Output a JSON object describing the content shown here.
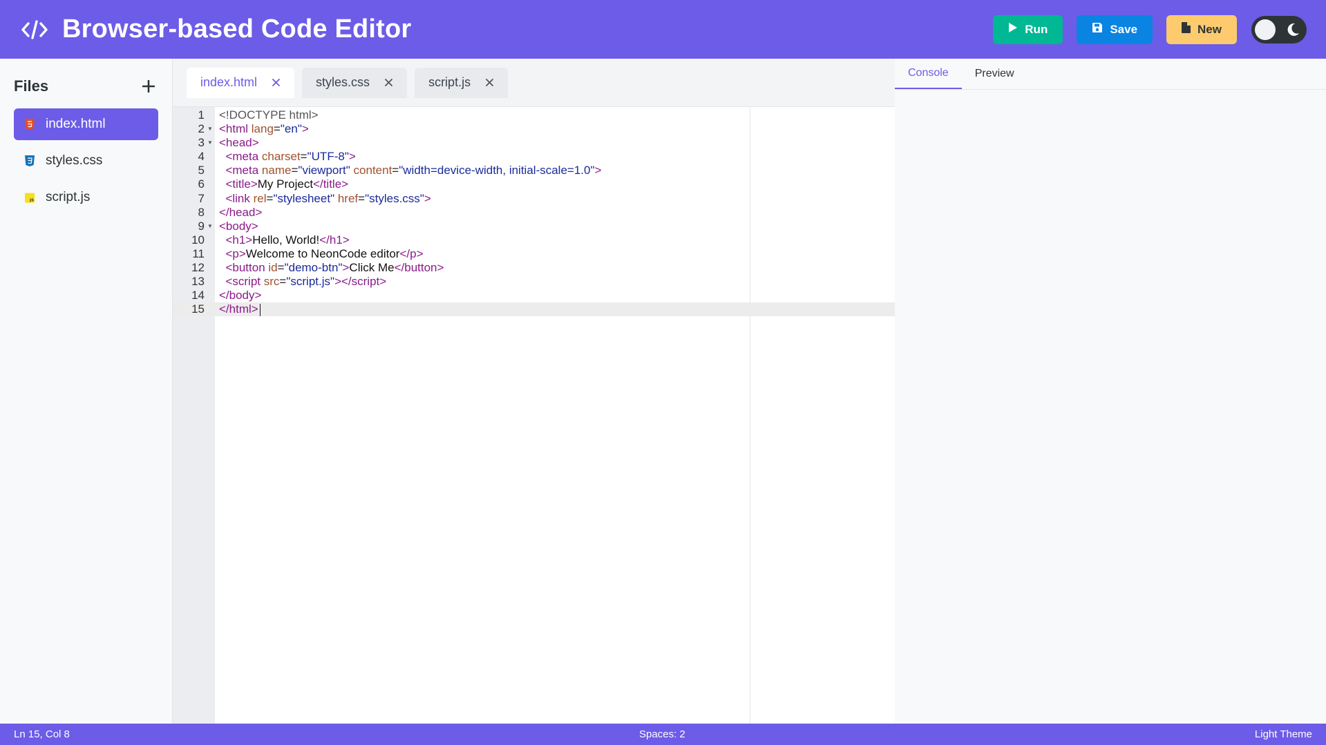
{
  "header": {
    "title": "Browser-based Code Editor",
    "logo_icon": "code-icon",
    "buttons": {
      "run": "Run",
      "save": "Save",
      "new": "New"
    },
    "colors": {
      "bar": "#6c5ce7",
      "run": "#00b894",
      "save": "#0984e3",
      "new": "#fdcb6e"
    }
  },
  "sidebar": {
    "title": "Files",
    "files": [
      {
        "name": "index.html",
        "icon": "html5-icon",
        "active": true
      },
      {
        "name": "styles.css",
        "icon": "css3-icon",
        "active": false
      },
      {
        "name": "script.js",
        "icon": "js-icon",
        "active": false
      }
    ]
  },
  "tabs": [
    {
      "label": "index.html",
      "active": true
    },
    {
      "label": "styles.css",
      "active": false
    },
    {
      "label": "script.js",
      "active": false
    }
  ],
  "editor": {
    "lines": [
      {
        "n": "1"
      },
      {
        "n": "2"
      },
      {
        "n": "3"
      },
      {
        "n": "4"
      },
      {
        "n": "5"
      },
      {
        "n": "6"
      },
      {
        "n": "7"
      },
      {
        "n": "8"
      },
      {
        "n": "9"
      },
      {
        "n": "10"
      },
      {
        "n": "11"
      },
      {
        "n": "12"
      },
      {
        "n": "13"
      },
      {
        "n": "14"
      },
      {
        "n": "15"
      }
    ],
    "code": {
      "doctype": "<!DOCTYPE html>",
      "html_lang": "en",
      "meta_charset": "UTF-8",
      "meta_name": "viewport",
      "meta_content": "width=device-width, initial-scale=1.0",
      "title": "My Project",
      "link_rel": "stylesheet",
      "link_href": "styles.css",
      "h1": "Hello, World!",
      "p": "Welcome to NeonCode editor",
      "button_id": "demo-btn",
      "button_text": "Click Me",
      "script_src": "script.js"
    }
  },
  "right_panel": {
    "tabs": [
      {
        "label": "Console",
        "active": true
      },
      {
        "label": "Preview",
        "active": false
      }
    ]
  },
  "statusbar": {
    "position": "Ln 15, Col 8",
    "indent": "Spaces: 2",
    "theme": "Light Theme"
  }
}
